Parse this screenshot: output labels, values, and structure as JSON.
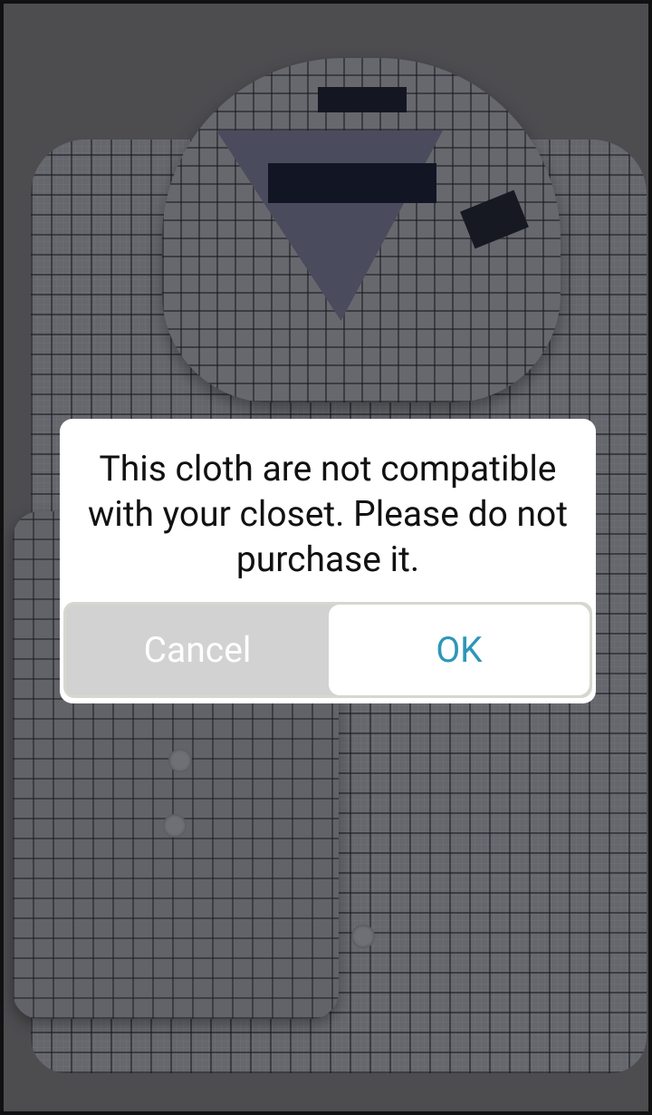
{
  "background": {
    "image_subject": "folded plaid dress shirt"
  },
  "dialog": {
    "message": "This cloth are not compatible with your closet. Please do not purchase it.",
    "cancel_label": "Cancel",
    "ok_label": "OK"
  },
  "colors": {
    "ok_text": "#2e96b8",
    "cancel_text": "#ffffff",
    "cancel_bg": "#d2d2d2",
    "dialog_bg": "#ffffff"
  }
}
